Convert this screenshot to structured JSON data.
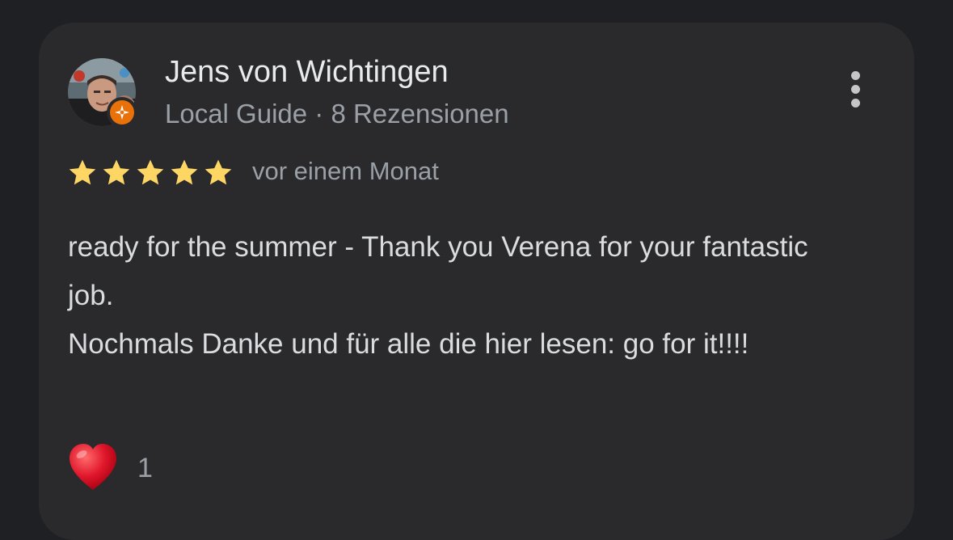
{
  "reviewer": {
    "name": "Jens von Wichtingen",
    "meta": "Local Guide · 8 Rezensionen"
  },
  "rating": {
    "stars": 5,
    "max": 5,
    "star_color": "#fdd663",
    "time": "vor einem Monat"
  },
  "review": {
    "paragraph_1": "ready for the summer - Thank you Verena for your fantastic job.",
    "paragraph_2": "Nochmals Danke und für alle die hier lesen: go for it!!!!"
  },
  "reactions": {
    "icon": "heart-icon",
    "count": "1"
  },
  "colors": {
    "background": "#1f2023",
    "card": "#2a2a2d",
    "local_guide_badge": "#e8710a"
  }
}
